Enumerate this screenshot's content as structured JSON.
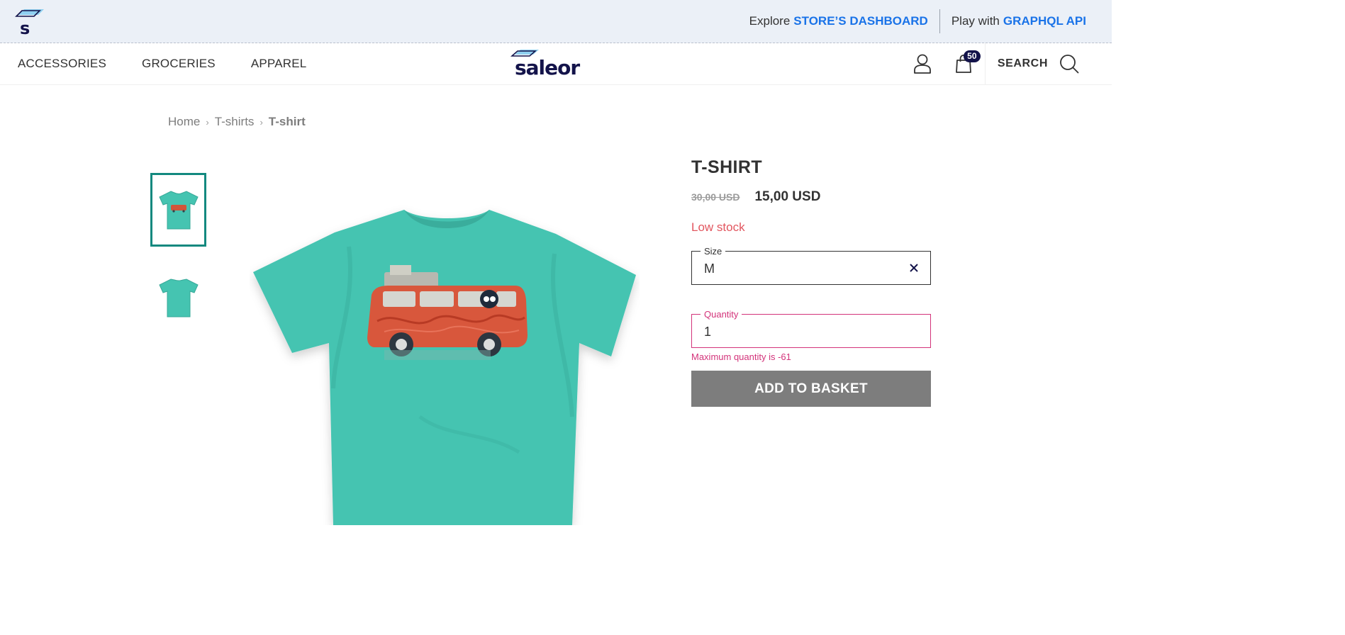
{
  "topbar": {
    "demo_logo_icon": "saleor-demo-logo",
    "dashboard_prefix": "Explore",
    "dashboard_label": "STORE’S DASHBOARD",
    "api_prefix": "Play with",
    "api_label": "GRAPHQL API",
    "link_color": "#1a73e8"
  },
  "nav": {
    "items": [
      {
        "label": "ACCESSORIES"
      },
      {
        "label": "GROCERIES"
      },
      {
        "label": "APPAREL"
      }
    ],
    "brand": "saleor",
    "user_icon": "user-icon",
    "cart_icon": "shopping-bag-icon",
    "cart_count": "50",
    "search_label": "SEARCH",
    "search_icon": "search-icon"
  },
  "breadcrumb": {
    "items": [
      "Home",
      "T-shirts"
    ],
    "separator": "›",
    "current": "T-shirt"
  },
  "gallery": {
    "thumbnails": [
      {
        "name": "t-shirt-front",
        "selected": true
      },
      {
        "name": "t-shirt-back",
        "selected": false
      }
    ],
    "active_border_color": "#13897f",
    "shirt_color": "#45c4b1"
  },
  "product": {
    "title": "T-SHIRT",
    "old_price": "30,00 USD",
    "price": "15,00 USD",
    "stock_status": "Low stock",
    "stock_color": "#e2565f",
    "size": {
      "label": "Size",
      "value": "M",
      "clear_icon": "close-icon"
    },
    "quantity": {
      "label": "Quantity",
      "value": "1",
      "error": "Maximum quantity is -61",
      "error_color": "#d3337a"
    },
    "add_button": "ADD TO BASKET",
    "add_button_color": "#7d7d7d"
  }
}
